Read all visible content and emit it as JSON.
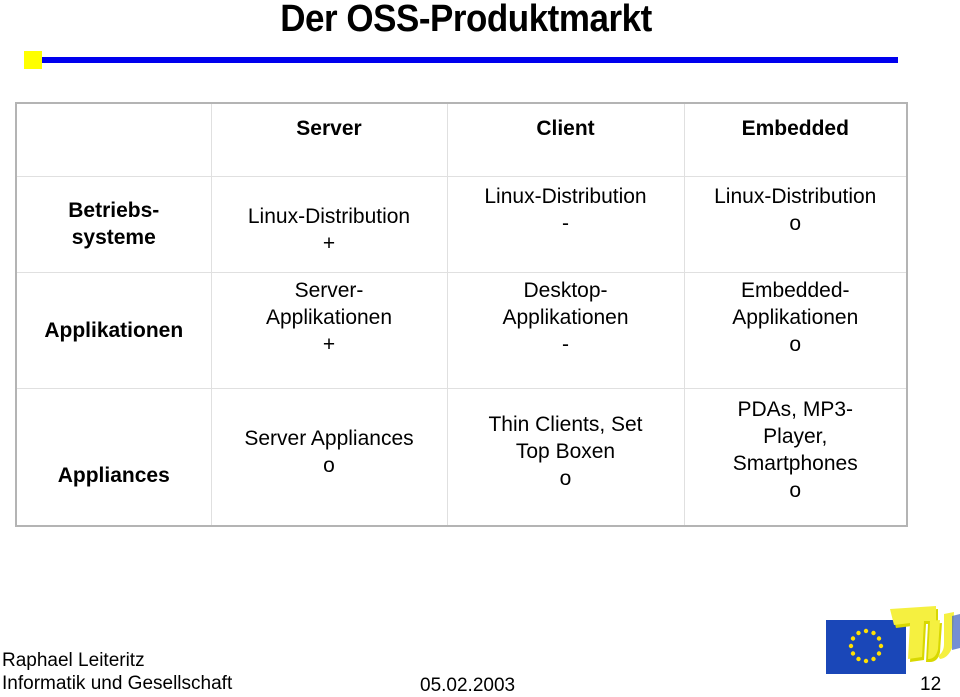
{
  "slide": {
    "title": "Der OSS-Produktmarkt",
    "accent_colors": {
      "rule_square": "#ffff00",
      "rule_line": "#0000ee"
    }
  },
  "table": {
    "columns": [
      "",
      "Server",
      "Client",
      "Embedded"
    ],
    "rows": [
      {
        "header": [
          "Betriebs-",
          "systeme"
        ],
        "cells": [
          [
            "Linux-Distribution",
            "+"
          ],
          [
            "Linux-Distribution",
            "-"
          ],
          [
            "Linux-Distribution",
            "o"
          ]
        ]
      },
      {
        "header": [
          "Applikationen"
        ],
        "cells": [
          [
            "Server-",
            "Applikationen",
            "+"
          ],
          [
            "Desktop-",
            "Applikationen",
            "-"
          ],
          [
            "Embedded-",
            "Applikationen",
            "o"
          ]
        ]
      },
      {
        "header": [
          "Appliances"
        ],
        "cells": [
          [
            "Server Appliances",
            "o"
          ],
          [
            "Thin Clients, Set",
            "Top Boxen",
            "o"
          ],
          [
            "PDAs, MP3-",
            "Player,",
            "Smartphones",
            "o"
          ]
        ]
      }
    ]
  },
  "footer": {
    "author": "Raphael Leiteritz",
    "course": "Informatik und Gesellschaft",
    "date": "05.02.2003",
    "page_number": "12",
    "logo": "eu-flag-tu-berlin-logo"
  }
}
